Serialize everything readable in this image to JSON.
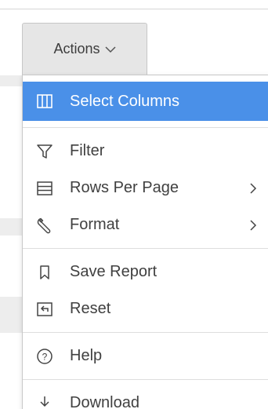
{
  "actions_button": {
    "label": "Actions",
    "icon": "chevron-down-icon"
  },
  "menu": {
    "accent_color": "#4a90e8",
    "groups": [
      {
        "items": [
          {
            "label": "Select Columns",
            "icon": "columns-icon",
            "selected": true
          }
        ]
      },
      {
        "items": [
          {
            "label": "Filter",
            "icon": "filter-icon"
          },
          {
            "label": "Rows Per Page",
            "icon": "rows-icon",
            "submenu": true
          },
          {
            "label": "Format",
            "icon": "wrench-icon",
            "submenu": true
          }
        ]
      },
      {
        "items": [
          {
            "label": "Save Report",
            "icon": "bookmark-icon"
          },
          {
            "label": "Reset",
            "icon": "reset-icon"
          }
        ]
      },
      {
        "items": [
          {
            "label": "Help",
            "icon": "help-icon"
          }
        ]
      },
      {
        "items": [
          {
            "label": "Download",
            "icon": "download-icon"
          }
        ]
      }
    ]
  }
}
